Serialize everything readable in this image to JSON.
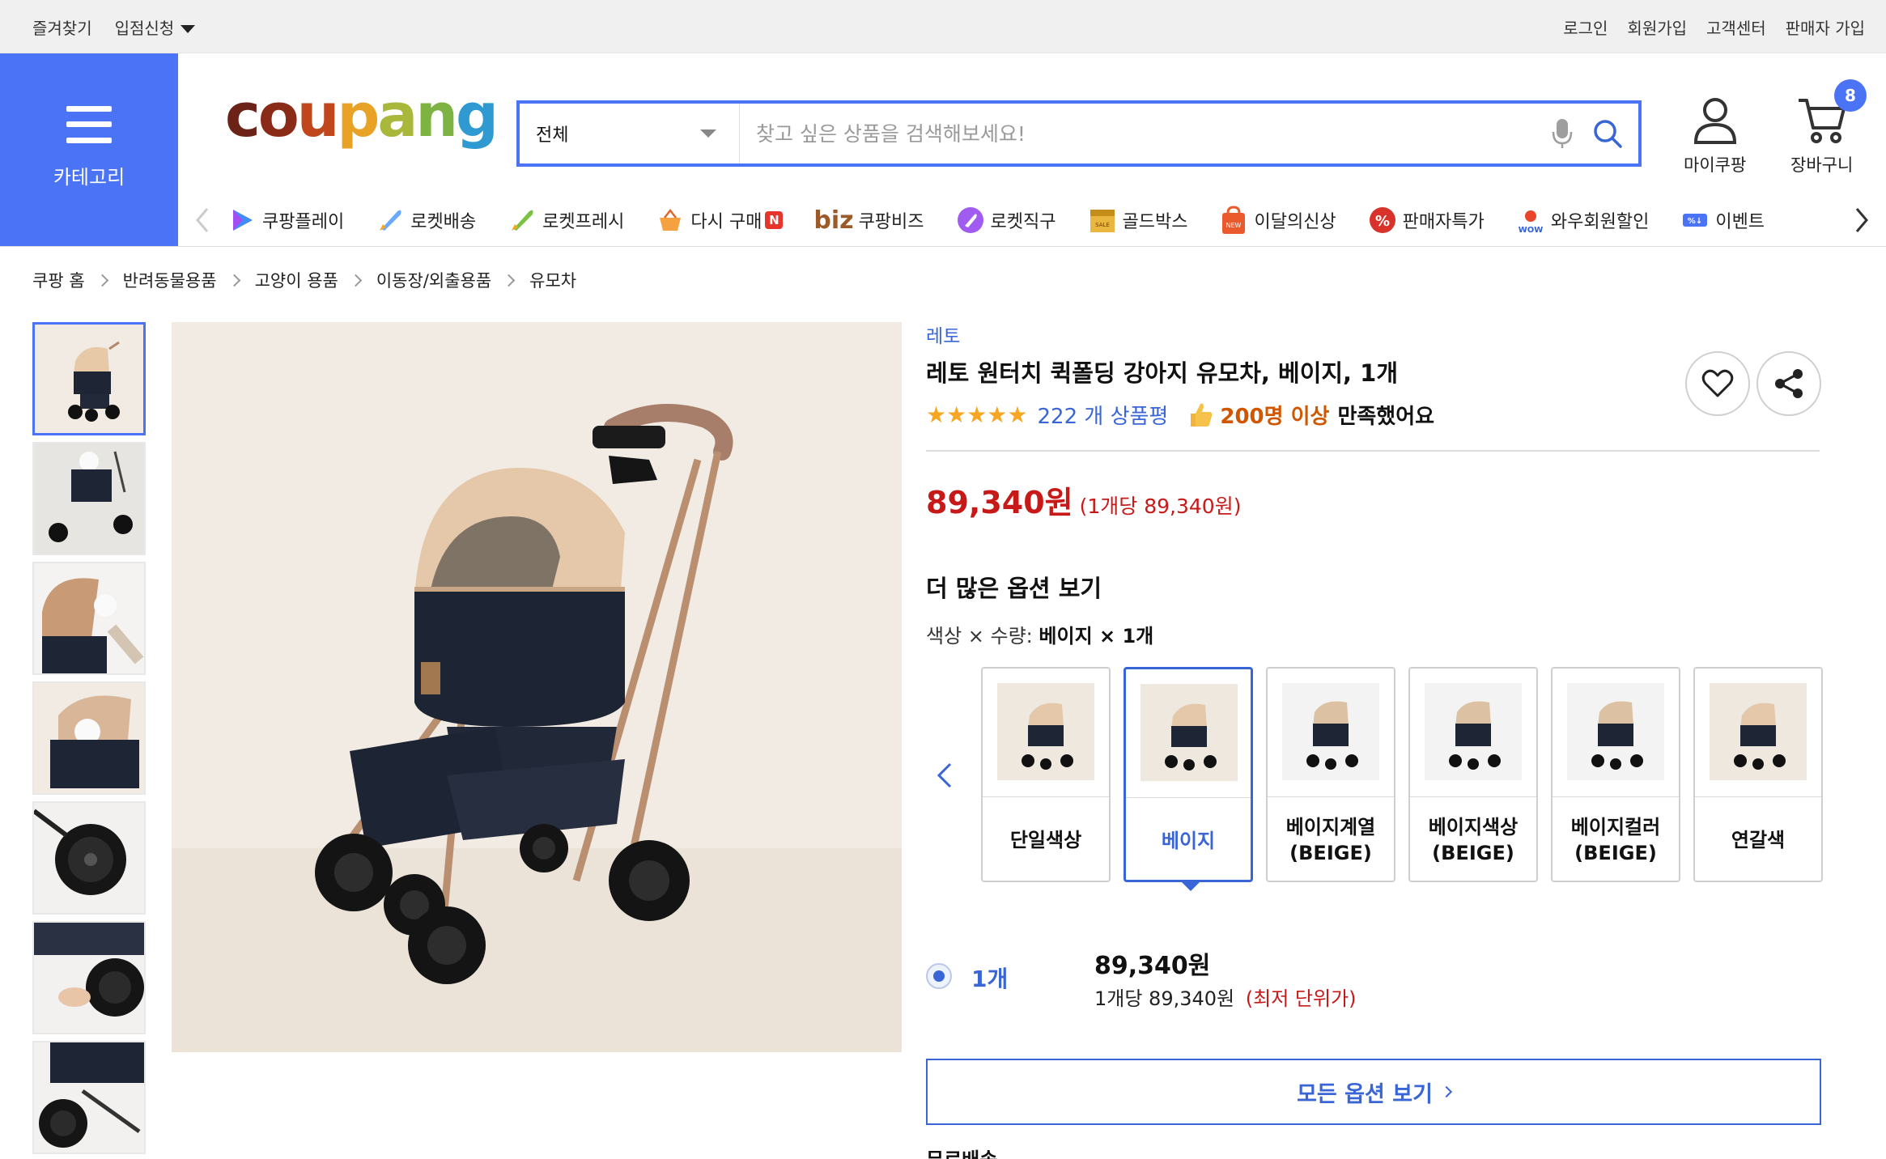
{
  "topbar": {
    "favorites": "즐겨찾기",
    "seller_apply": "입점신청",
    "login": "로그인",
    "signup": "회원가입",
    "customer_center": "고객센터",
    "seller_signup": "판매자 가입"
  },
  "header": {
    "category_label": "카테고리",
    "logo": "coupang",
    "search_category": "전체",
    "search_placeholder": "찾고 싶은 상품을 검색해보세요!",
    "mycoupang_label": "마이쿠팡",
    "cart_label": "장바구니",
    "cart_count": "8",
    "brand_colors": [
      "#6b2217",
      "#c0461b",
      "#e8a226",
      "#7cb342",
      "#2f9ad1"
    ]
  },
  "quicknav": {
    "items": [
      {
        "label": "쿠팡플레이",
        "icon": "play-icon"
      },
      {
        "label": "로켓배송",
        "icon": "rocket-icon"
      },
      {
        "label": "로켓프레시",
        "icon": "rocket-fresh-icon"
      },
      {
        "label": "다시 구매",
        "icon": "basket-icon",
        "badge": "N"
      },
      {
        "label": "쿠팡비즈",
        "icon": "biz-icon",
        "prefix": "biz"
      },
      {
        "label": "로켓직구",
        "icon": "global-rocket-icon"
      },
      {
        "label": "골드박스",
        "icon": "goldbox-icon"
      },
      {
        "label": "이달의신상",
        "icon": "new-bag-icon"
      },
      {
        "label": "판매자특가",
        "icon": "percent-icon"
      },
      {
        "label": "와우회원할인",
        "icon": "wow-icon"
      },
      {
        "label": "이벤트",
        "icon": "event-icon"
      }
    ]
  },
  "breadcrumb": [
    "쿠팡 홈",
    "반려동물용품",
    "고양이 용품",
    "이동장/외출용품",
    "유모차"
  ],
  "product": {
    "brand": "레토",
    "title": "레토 원터치 퀵폴딩 강아지 유모차, 베이지, 1개",
    "stars": "★★★★★",
    "review_count": "222 개 상품평",
    "satisfaction_num": "200명 이상",
    "satisfaction_txt": "만족했어요",
    "price": "89,340원",
    "unit_price": "(1개당 89,340원)",
    "more_options": "더 많은 옵션 보기",
    "option_prefix": "색상 × 수량: ",
    "option_value": "베이지 × 1개"
  },
  "options": [
    {
      "label": "단일색상",
      "selected": false
    },
    {
      "label": "베이지",
      "selected": true
    },
    {
      "label": "베이지계열\n(BEIGE)",
      "selected": false
    },
    {
      "label": "베이지색상\n(BEIGE)",
      "selected": false
    },
    {
      "label": "베이지컬러\n(BEIGE)",
      "selected": false
    },
    {
      "label": "연갈색",
      "selected": false
    }
  ],
  "quantity": {
    "label": "1개",
    "price": "89,340원",
    "unit": "1개당 89,340원",
    "lowest": "(최저 단위가)"
  },
  "all_options_button": "모든 옵션 보기",
  "cutoff_text": "무료배송"
}
